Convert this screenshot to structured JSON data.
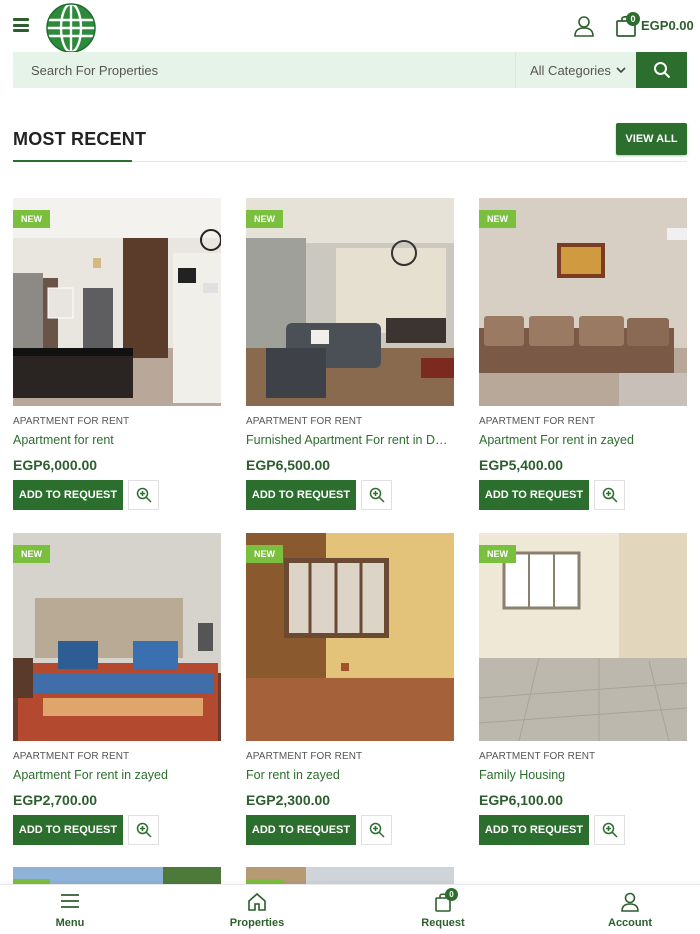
{
  "header": {
    "cart_count": "0",
    "cart_total": "EGP0.00"
  },
  "search": {
    "placeholder": "Search For Properties",
    "category": "All Categories"
  },
  "section": {
    "title": "MOST RECENT",
    "view_all": "VIEW ALL"
  },
  "products": [
    {
      "badge": "NEW",
      "category": "APARTMENT FOR RENT",
      "title": "Apartment for rent",
      "price": "EGP6,000.00",
      "button": "ADD TO REQUEST"
    },
    {
      "badge": "NEW",
      "category": "APARTMENT FOR RENT",
      "title": "Furnished Apartment For rent in Dar Misr Dar Misr Dar Misr",
      "price": "EGP6,500.00",
      "button": "ADD TO REQUEST"
    },
    {
      "badge": "NEW",
      "category": "APARTMENT FOR RENT",
      "title": "Apartment For rent in zayed",
      "price": "EGP5,400.00",
      "button": "ADD TO REQUEST"
    },
    {
      "badge": "NEW",
      "category": "APARTMENT FOR RENT",
      "title": "Apartment For rent in zayed",
      "price": "EGP2,700.00",
      "button": "ADD TO REQUEST"
    },
    {
      "badge": "NEW",
      "category": "APARTMENT FOR RENT",
      "title": "For rent in zayed",
      "price": "EGP2,300.00",
      "button": "ADD TO REQUEST"
    },
    {
      "badge": "NEW",
      "category": "APARTMENT FOR RENT",
      "title": "Family Housing",
      "price": "EGP6,100.00",
      "button": "ADD TO REQUEST"
    }
  ],
  "bottom_nav": {
    "menu": "Menu",
    "properties": "Properties",
    "request": "Request",
    "request_count": "0",
    "account": "Account"
  },
  "colors": {
    "brand_green": "#2c6e2e",
    "badge_green": "#7bbf3f",
    "search_bg": "#e6f3e8"
  }
}
